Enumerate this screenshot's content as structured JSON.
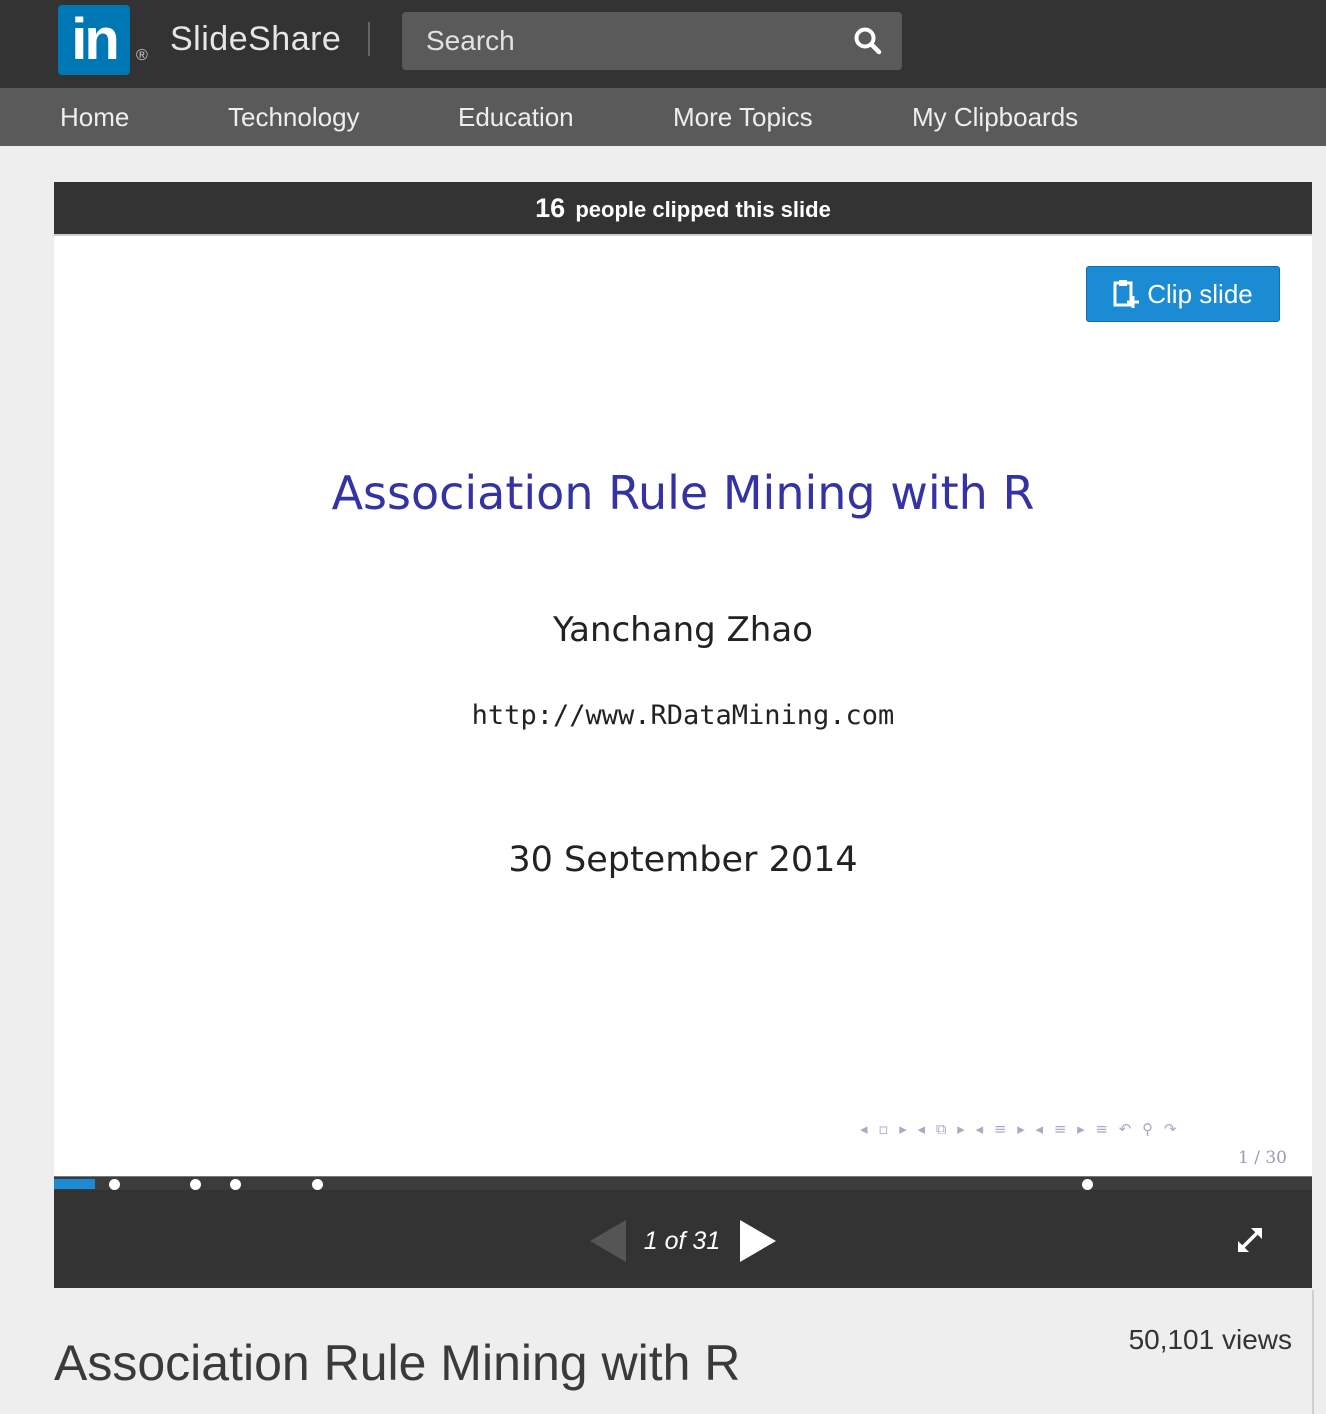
{
  "header": {
    "logo_text": "in",
    "registered_mark": "®",
    "brand_name": "SlideShare",
    "search_placeholder": "Search"
  },
  "nav": {
    "items": [
      "Home",
      "Technology",
      "Education",
      "More Topics",
      "My Clipboards"
    ]
  },
  "player": {
    "clipped_count": "16",
    "clipped_text": "people clipped this slide",
    "clip_button_label": "Clip slide",
    "slide": {
      "title": "Association Rule Mining with R",
      "author": "Yanchang Zhao",
      "url": "http://www.RDataMining.com",
      "date": "30 September 2014",
      "nav_symbols": "◂ ▫ ▸  ◂ ⧉ ▸  ◂ ≡ ▸  ◂ ≡ ▸   ≡   ↶ ⚲ ↷",
      "page_label": "1 / 30"
    },
    "current_slide": 1,
    "total_slides": 31,
    "page_indicator": "1 of 31",
    "accent_color": "#1b8bd3"
  },
  "content": {
    "views": "50,101 views",
    "title": "Association Rule Mining with R"
  }
}
